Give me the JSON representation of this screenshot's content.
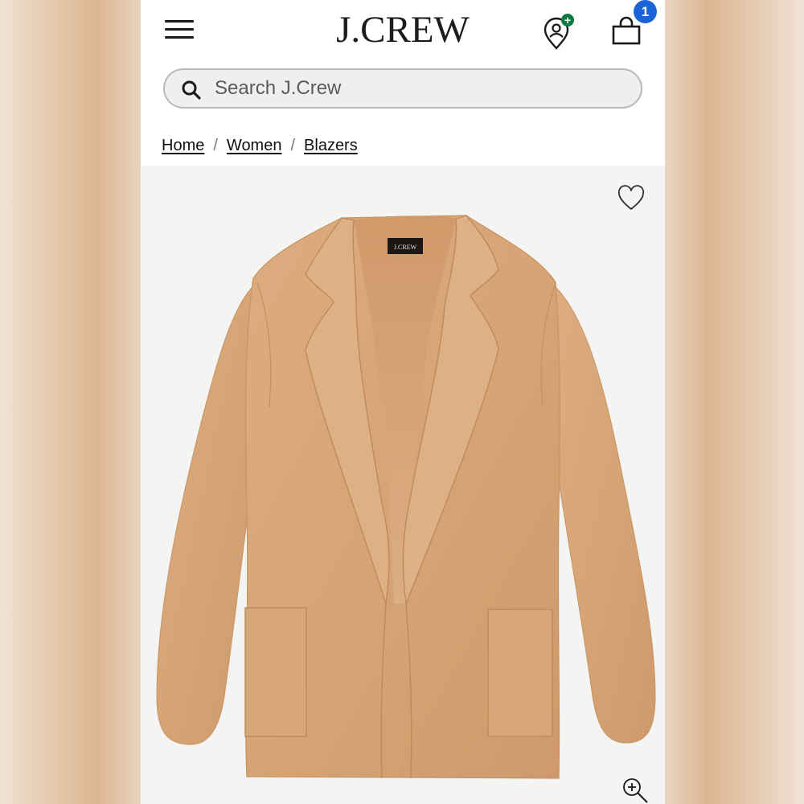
{
  "header": {
    "logo": "J.CREW",
    "menu_icon": "hamburger-menu-icon",
    "location_icon": "store-location-icon",
    "bag_icon": "shopping-bag-icon",
    "bag_count": "1"
  },
  "search": {
    "placeholder": "Search J.Crew",
    "icon": "search-icon"
  },
  "breadcrumb": {
    "items": [
      {
        "label": "Home"
      },
      {
        "label": "Women"
      },
      {
        "label": "Blazers"
      }
    ],
    "separator": "/"
  },
  "product": {
    "image": "camel sweater blazer",
    "garment_label": "J.CREW",
    "colors": {
      "garment": "#d8a77a",
      "badge": "#1a64d8",
      "plus": "#0f7a3d"
    },
    "wishlist_icon": "heart-icon",
    "zoom_icon": "zoom-in-icon"
  }
}
